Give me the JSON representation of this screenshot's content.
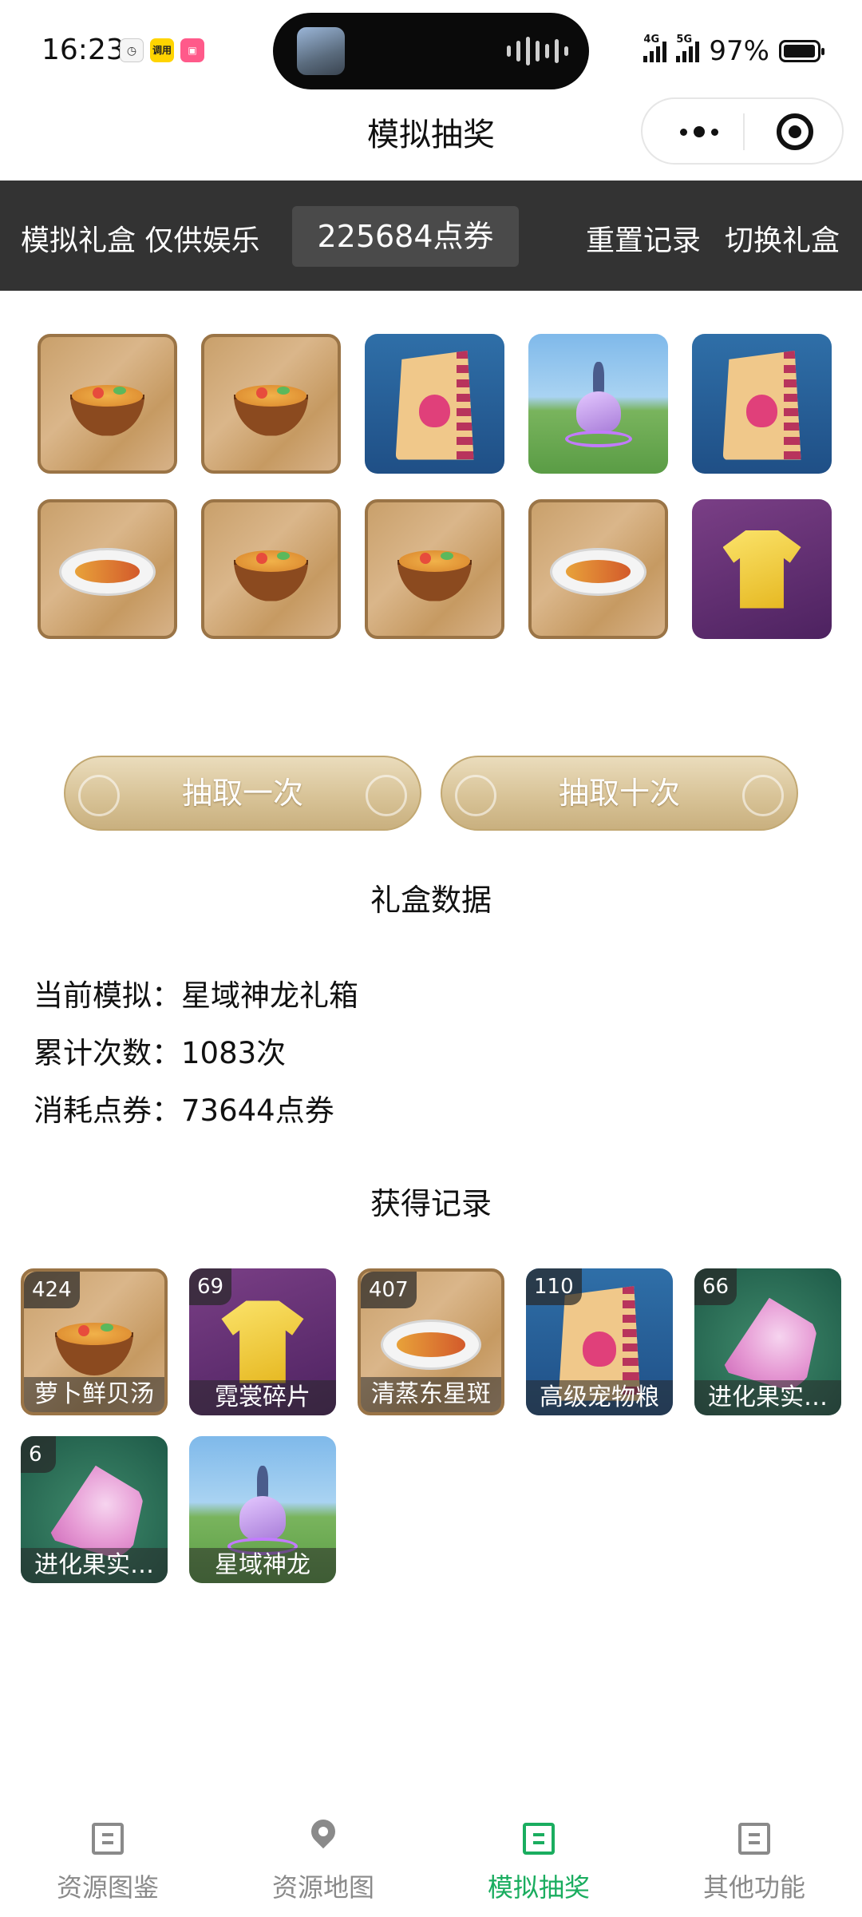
{
  "status_bar": {
    "time": "16:23",
    "battery": "97%",
    "network_1": "4G",
    "network_2": "5G",
    "app_badge_1": "调用"
  },
  "nav": {
    "title": "模拟抽奖"
  },
  "toolbar": {
    "label": "模拟礼盒 仅供娱乐",
    "points": "225684点券",
    "reset": "重置记录",
    "switch": "切换礼盒"
  },
  "reward_grid": [
    {
      "icon": "soup-icon",
      "bg": "wood"
    },
    {
      "icon": "soup-icon",
      "bg": "wood"
    },
    {
      "icon": "pet-food-bag-icon",
      "bg": "blue"
    },
    {
      "icon": "dragon-icon",
      "bg": "sky"
    },
    {
      "icon": "pet-food-bag-icon",
      "bg": "blue"
    },
    {
      "icon": "fish-dish-icon",
      "bg": "wood"
    },
    {
      "icon": "soup-icon",
      "bg": "wood"
    },
    {
      "icon": "soup-icon",
      "bg": "wood"
    },
    {
      "icon": "fish-dish-icon",
      "bg": "wood"
    },
    {
      "icon": "shirt-icon",
      "bg": "purple"
    }
  ],
  "buttons": {
    "draw_once": "抽取一次",
    "draw_ten": "抽取十次"
  },
  "box_data": {
    "title": "礼盒数据",
    "current": "当前模拟：星域神龙礼箱",
    "total": "累计次数：1083次",
    "spent": "消耗点券：73644点券"
  },
  "records": {
    "title": "获得记录",
    "items": [
      {
        "count": "424",
        "name": "萝卜鲜贝汤",
        "icon": "soup-icon",
        "bg": "wood"
      },
      {
        "count": "69",
        "name": "霓裳碎片",
        "icon": "shirt-icon",
        "bg": "purple"
      },
      {
        "count": "407",
        "name": "清蒸东星斑",
        "icon": "fish-dish-icon",
        "bg": "wood"
      },
      {
        "count": "110",
        "name": "高级宠物粮",
        "icon": "pet-food-bag-icon",
        "bg": "blue"
      },
      {
        "count": "66",
        "name": "进化果实…",
        "icon": "evolution-fruit-icon",
        "bg": "teal"
      },
      {
        "count": "6",
        "name": "进化果实…",
        "icon": "evolution-fruit-icon",
        "bg": "teal"
      },
      {
        "count": "",
        "name": "星域神龙",
        "icon": "dragon-icon",
        "bg": "sky"
      }
    ]
  },
  "tabs": [
    {
      "label": "资源图鉴",
      "icon": "book-icon",
      "active": false
    },
    {
      "label": "资源地图",
      "icon": "map-pin-icon",
      "active": false
    },
    {
      "label": "模拟抽奖",
      "icon": "list-icon",
      "active": true
    },
    {
      "label": "其他功能",
      "icon": "more-icon",
      "active": false
    }
  ],
  "colors": {
    "accent": "#1aad5f",
    "toolbar_bg": "#333333",
    "button_gold": "#d8c397"
  }
}
